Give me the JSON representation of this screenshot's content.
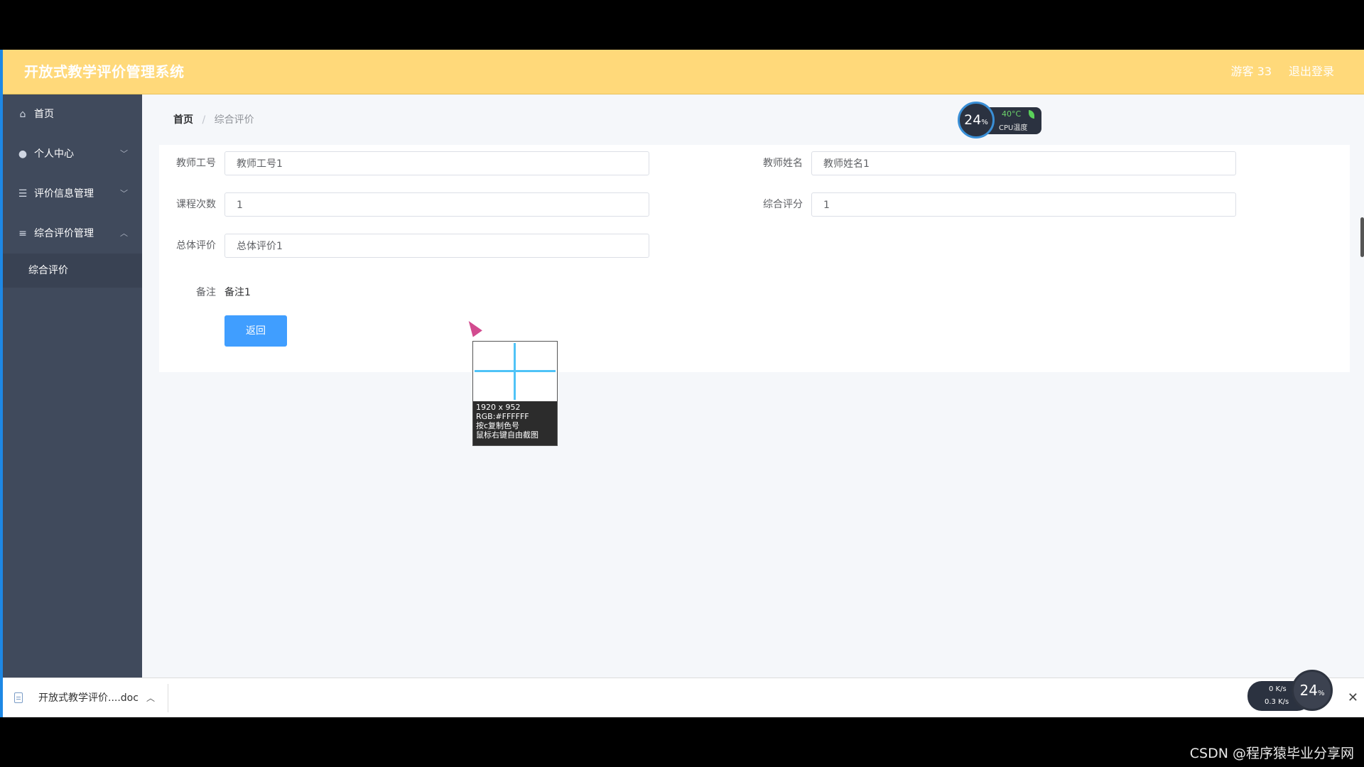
{
  "header": {
    "app_title": "开放式教学评价管理系统",
    "user_text": "游客 33",
    "logout_label": "退出登录"
  },
  "sidebar": {
    "items": [
      {
        "label": "首页",
        "icon": "home-icon"
      },
      {
        "label": "个人中心",
        "icon": "user-icon",
        "chevron": "down"
      },
      {
        "label": "评价信息管理",
        "icon": "sliders-icon",
        "chevron": "down"
      },
      {
        "label": "综合评价管理",
        "icon": "menu-icon",
        "chevron": "up"
      }
    ],
    "subitems": [
      {
        "label": "综合评价"
      }
    ]
  },
  "breadcrumb": {
    "home": "首页",
    "separator": "/",
    "current": "综合评价"
  },
  "form": {
    "teacher_id_label": "教师工号",
    "teacher_id_value": "教师工号1",
    "teacher_name_label": "教师姓名",
    "teacher_name_value": "教师姓名1",
    "course_count_label": "课程次数",
    "course_count_value": "1",
    "overall_score_label": "综合评分",
    "overall_score_value": "1",
    "overall_eval_label": "总体评价",
    "overall_eval_value": "总体评价1",
    "note_label": "备注",
    "note_value": "备注1",
    "back_button": "返回"
  },
  "cpu_widget": {
    "percent": "24",
    "percent_unit": "%",
    "temp": "40°C",
    "label": "CPU温度"
  },
  "color_picker": {
    "size": "1920 x 952",
    "rgb": "RGB:#FFFFFF",
    "hint1": "按c复制色号",
    "hint2": "鼠标右键自由截图"
  },
  "download_bar": {
    "file_name": "开放式教学评价....doc",
    "net_up": "0 K/s",
    "net_down": "0.3 K/s",
    "net_percent": "24",
    "percent_unit": "%",
    "close": "✕"
  },
  "watermark": "CSDN @程序猿毕业分享网",
  "colors": {
    "header_bg": "#ffd97a",
    "sidebar_bg": "#404a5c",
    "primary_button": "#409eff",
    "page_bg": "#f5f7fa"
  }
}
